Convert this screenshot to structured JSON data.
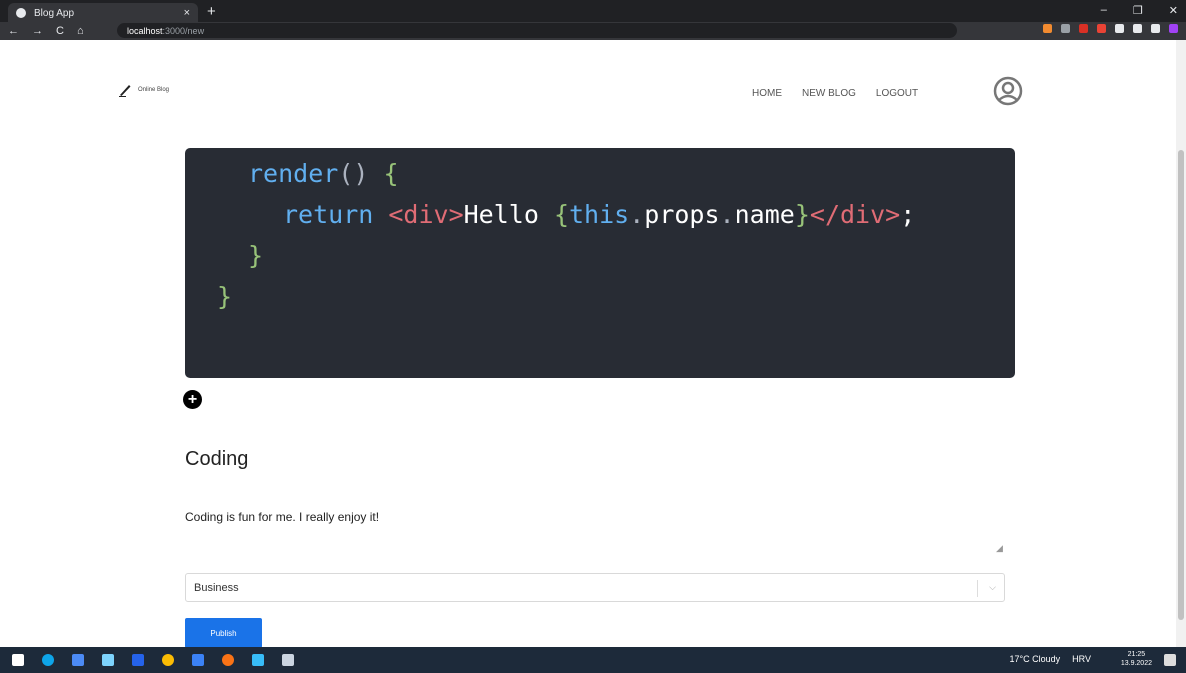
{
  "browser": {
    "tab_title": "Blog App",
    "tab_close": "×",
    "new_tab": "+",
    "url_host": "localhost",
    "url_path": ":3000/new",
    "nav_back": "←",
    "nav_forward": "→",
    "nav_reload": "C",
    "nav_home": "⌂",
    "win_min": "–",
    "win_max": "❐",
    "win_close": "✕"
  },
  "header": {
    "brand": "Online Blog",
    "menu": [
      "HOME",
      "NEW BLOG",
      "LOGOUT"
    ]
  },
  "editor": {
    "code_lines": [
      {
        "indent": "  ",
        "text": "render() {"
      },
      {
        "indent": "    ",
        "text": "return <div>Hello {this.props.name}</div>;"
      },
      {
        "indent": "  ",
        "text": "}"
      },
      {
        "indent": "",
        "text": "}"
      }
    ],
    "add_button": "+",
    "title": "Coding",
    "body": "Coding is fun for me. I really enjoy it!",
    "category_selected": "Business",
    "publish_label": "Publish"
  },
  "taskbar": {
    "weather": "17°C  Cloudy",
    "lang": "HRV",
    "time": "21:25",
    "date": "13.9.2022"
  },
  "colors": {
    "code_bg": "#282c34",
    "keyword": "#61afef",
    "tag": "#e06c75",
    "brace": "#98c379",
    "publish": "#1a73e8"
  }
}
